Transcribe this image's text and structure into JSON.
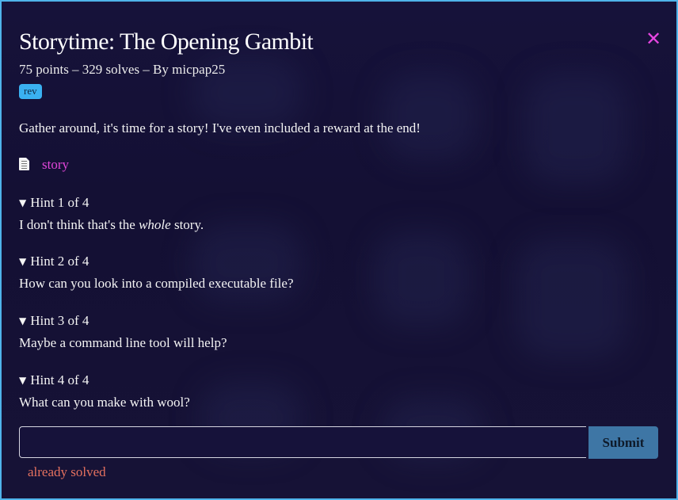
{
  "challenge": {
    "title": "Storytime: The Opening Gambit",
    "meta": "75 points – 329 solves – By micpap25",
    "tag": "rev",
    "description": "Gather around, it's time for a story! I've even included a reward at the end!",
    "file": {
      "icon": "document-icon",
      "name": "story"
    }
  },
  "hints": [
    {
      "arrow": "▼",
      "label": "Hint 1 of 4",
      "text_before": "I don't think that's the ",
      "text_em": "whole",
      "text_after": " story."
    },
    {
      "arrow": "▼",
      "label": "Hint 2 of 4",
      "text": "How can you look into a compiled executable file?"
    },
    {
      "arrow": "▼",
      "label": "Hint 3 of 4",
      "text": "Maybe a command line tool will help?"
    },
    {
      "arrow": "▼",
      "label": "Hint 4 of 4",
      "text": "What can you make with wool?"
    }
  ],
  "form": {
    "input_value": "",
    "input_placeholder": "",
    "submit_label": "Submit",
    "status": "already solved"
  },
  "close": {
    "icon": "close-icon",
    "glyph": "✕"
  },
  "colors": {
    "border": "#4fb3ea",
    "background": "#16123a",
    "link": "#e046d9",
    "tag_bg": "#3ab1f1",
    "submit_bg": "#3e76a5",
    "status": "#e5715f"
  }
}
